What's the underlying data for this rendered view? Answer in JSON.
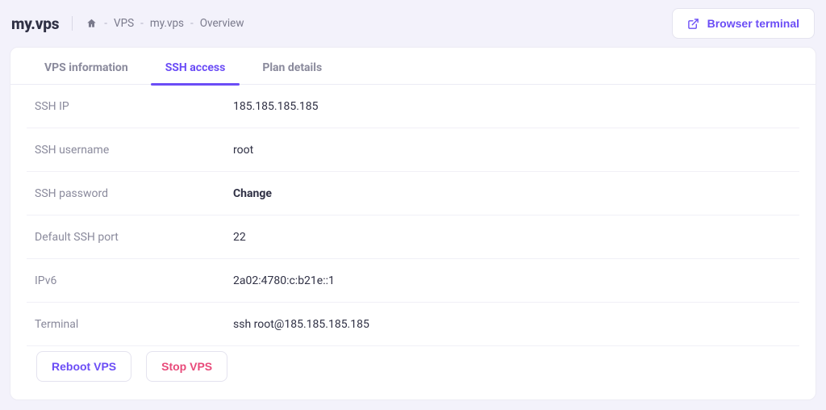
{
  "header": {
    "logo": "my.vps",
    "breadcrumb": {
      "p1": "VPS",
      "p2": "my.vps",
      "p3": "Overview"
    },
    "terminal_button": "Browser terminal"
  },
  "tabs": {
    "info": "VPS information",
    "ssh": "SSH access",
    "plan": "Plan details"
  },
  "ssh": {
    "rows": {
      "ip": {
        "label": "SSH IP",
        "value": "185.185.185.185"
      },
      "user": {
        "label": "SSH username",
        "value": "root"
      },
      "password": {
        "label": "SSH password",
        "value": "Change"
      },
      "port": {
        "label": "Default SSH port",
        "value": "22"
      },
      "ipv6": {
        "label": "IPv6",
        "value": "2a02:4780:c:b21e::1"
      },
      "terminal": {
        "label": "Terminal",
        "value": "ssh root@185.185.185.185"
      }
    }
  },
  "actions": {
    "reboot": "Reboot VPS",
    "stop": "Stop VPS"
  },
  "colors": {
    "accent_purple": "#6b4df6",
    "accent_pink": "#e84a7a",
    "bg": "#f3f2fb",
    "text_muted": "#8a8a9c"
  }
}
